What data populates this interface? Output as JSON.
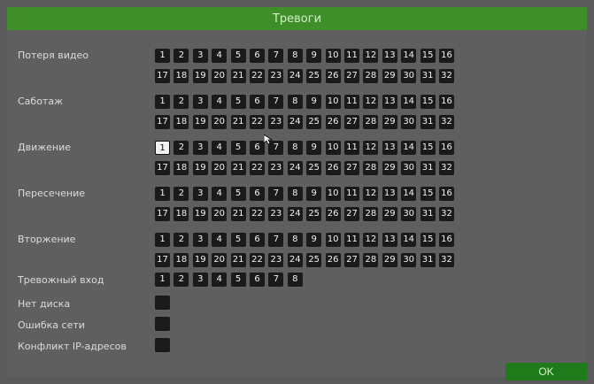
{
  "window": {
    "title": "Тревоги"
  },
  "alarm_rows": [
    {
      "label": "Потеря видео",
      "line1": [
        "1",
        "2",
        "3",
        "4",
        "5",
        "6",
        "7",
        "8",
        "9",
        "10",
        "11",
        "12",
        "13",
        "14",
        "15",
        "16"
      ],
      "line2": [
        "17",
        "18",
        "19",
        "20",
        "21",
        "22",
        "23",
        "24",
        "25",
        "26",
        "27",
        "28",
        "29",
        "30",
        "31",
        "32"
      ]
    },
    {
      "label": "Саботаж",
      "line1": [
        "1",
        "2",
        "3",
        "4",
        "5",
        "6",
        "7",
        "8",
        "9",
        "10",
        "11",
        "12",
        "13",
        "14",
        "15",
        "16"
      ],
      "line2": [
        "17",
        "18",
        "19",
        "20",
        "21",
        "22",
        "23",
        "24",
        "25",
        "26",
        "27",
        "28",
        "29",
        "30",
        "31",
        "32"
      ]
    },
    {
      "label": "Движение",
      "line1": [
        "1",
        "2",
        "3",
        "4",
        "5",
        "6",
        "7",
        "8",
        "9",
        "10",
        "11",
        "12",
        "13",
        "14",
        "15",
        "16"
      ],
      "line2": [
        "17",
        "18",
        "19",
        "20",
        "21",
        "22",
        "23",
        "24",
        "25",
        "26",
        "27",
        "28",
        "29",
        "30",
        "31",
        "32"
      ],
      "selected": "1"
    },
    {
      "label": "Пересечение",
      "line1": [
        "1",
        "2",
        "3",
        "4",
        "5",
        "6",
        "7",
        "8",
        "9",
        "10",
        "11",
        "12",
        "13",
        "14",
        "15",
        "16"
      ],
      "line2": [
        "17",
        "18",
        "19",
        "20",
        "21",
        "22",
        "23",
        "24",
        "25",
        "26",
        "27",
        "28",
        "29",
        "30",
        "31",
        "32"
      ]
    },
    {
      "label": "Вторжение",
      "line1": [
        "1",
        "2",
        "3",
        "4",
        "5",
        "6",
        "7",
        "8",
        "9",
        "10",
        "11",
        "12",
        "13",
        "14",
        "15",
        "16"
      ],
      "line2": [
        "17",
        "18",
        "19",
        "20",
        "21",
        "22",
        "23",
        "24",
        "25",
        "26",
        "27",
        "28",
        "29",
        "30",
        "31",
        "32"
      ]
    }
  ],
  "alarm_input": {
    "label": "Тревожный вход",
    "cells": [
      "1",
      "2",
      "3",
      "4",
      "5",
      "6",
      "7",
      "8"
    ]
  },
  "single_toggles": [
    {
      "label": "Нет диска"
    },
    {
      "label": "Ошибка сети"
    },
    {
      "label": "Конфликт IP-адресов"
    }
  ],
  "ok_button": {
    "label": "OK"
  }
}
